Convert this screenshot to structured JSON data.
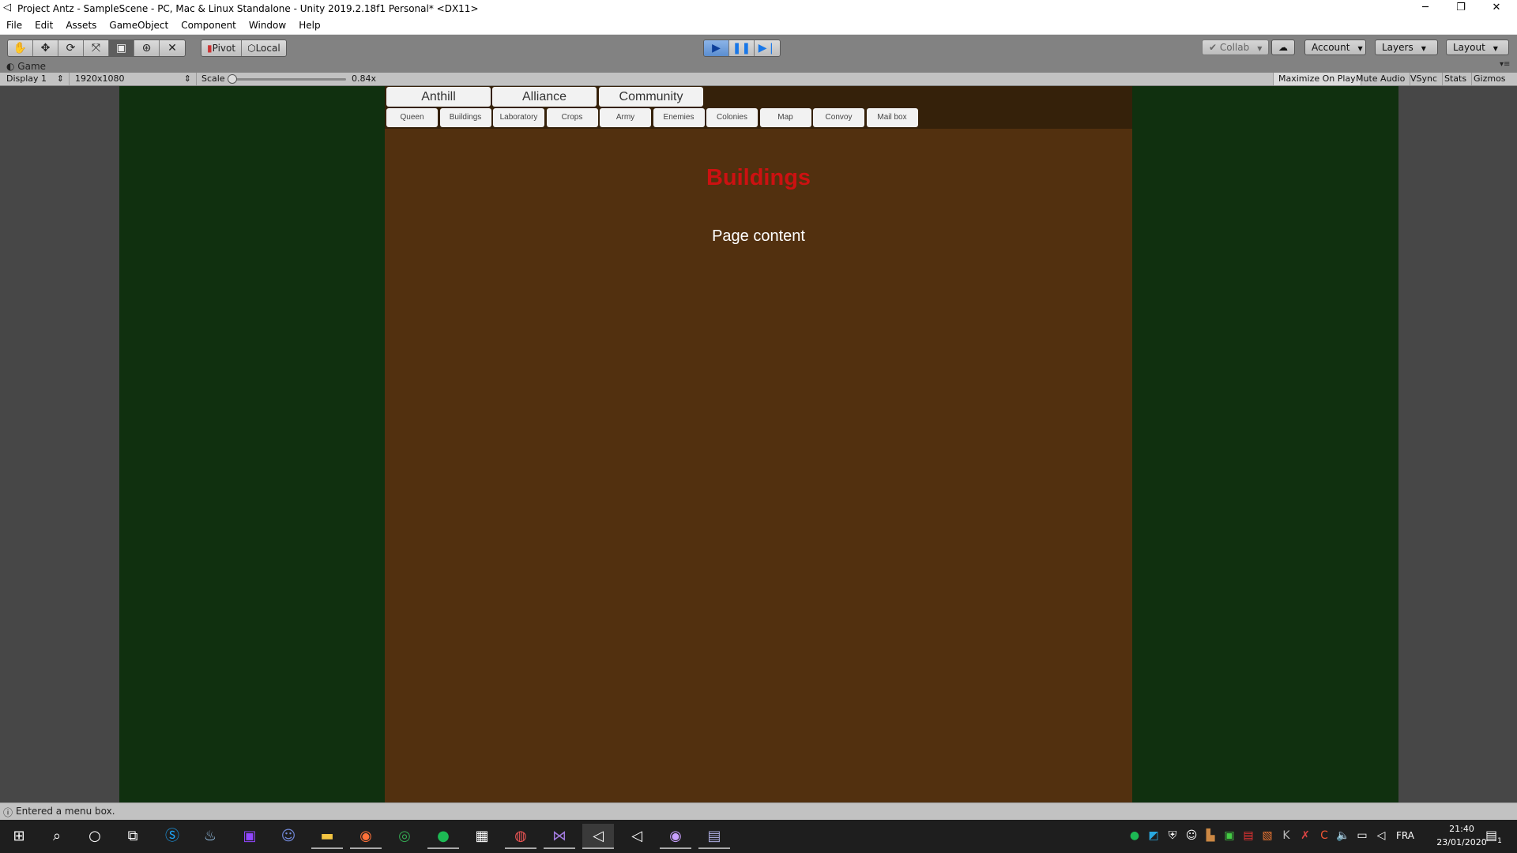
{
  "window": {
    "title": "Project Antz - SampleScene - PC, Mac & Linux Standalone - Unity 2019.2.18f1 Personal* <DX11>",
    "minimize": "─",
    "restore": "❐",
    "close": "✕"
  },
  "menu": [
    "File",
    "Edit",
    "Assets",
    "GameObject",
    "Component",
    "Window",
    "Help"
  ],
  "toolbar": {
    "tools": [
      "hand-icon",
      "move-icon",
      "rotate-icon",
      "scale-icon",
      "rect-icon",
      "transform-icon",
      "custom-icon"
    ],
    "pivot": "Pivot",
    "local": "Local",
    "collab": "Collab",
    "account": "Account",
    "layers": "Layers",
    "layout": "Layout",
    "play_state": "playing"
  },
  "game": {
    "tab": "Game",
    "display": "Display 1",
    "resolution": "1920x1080",
    "scale_label": "Scale",
    "scale_value": "0.84x",
    "scale_fraction": 0.0,
    "maximize": "Maximize On Play",
    "mute": "Mute Audio",
    "vsync": "VSync",
    "stats": "Stats",
    "gizmos": "Gizmos"
  },
  "panel": {
    "tabs": [
      "Anthill",
      "Alliance",
      "Community"
    ],
    "subtabs": [
      "Queen",
      "Buildings",
      "Laboratory",
      "Crops",
      "Army",
      "Enemies",
      "Colonies",
      "Map",
      "Convoy",
      "Mail box"
    ],
    "title": "Buildings",
    "content": "Page content",
    "colors": {
      "title": "#cc1111",
      "panel": "#52300f",
      "background": "#10300f"
    }
  },
  "status": {
    "message": "Entered a menu box."
  },
  "taskbar": {
    "apps": [
      "windows-start-icon",
      "search-icon",
      "cortana-icon",
      "task-view-icon",
      "skype-icon",
      "steam-icon",
      "twitch-icon",
      "discord-icon",
      "file-explorer-icon",
      "firefox-icon",
      "chrome-icon",
      "spotify-icon",
      "calculator-icon",
      "app-icon",
      "visual-studio-icon",
      "unity-icon",
      "unity-hub-icon",
      "app2-icon",
      "app3-icon"
    ],
    "tray": [
      "spotify",
      "speed",
      "security",
      "discord",
      "app",
      "app",
      "ccleaner",
      "app",
      "k",
      "network",
      "ccleaner",
      "volume",
      "network",
      "unity"
    ],
    "lang": "FRA",
    "time": "21:40",
    "date": "23/01/2020",
    "notifications": "1"
  }
}
